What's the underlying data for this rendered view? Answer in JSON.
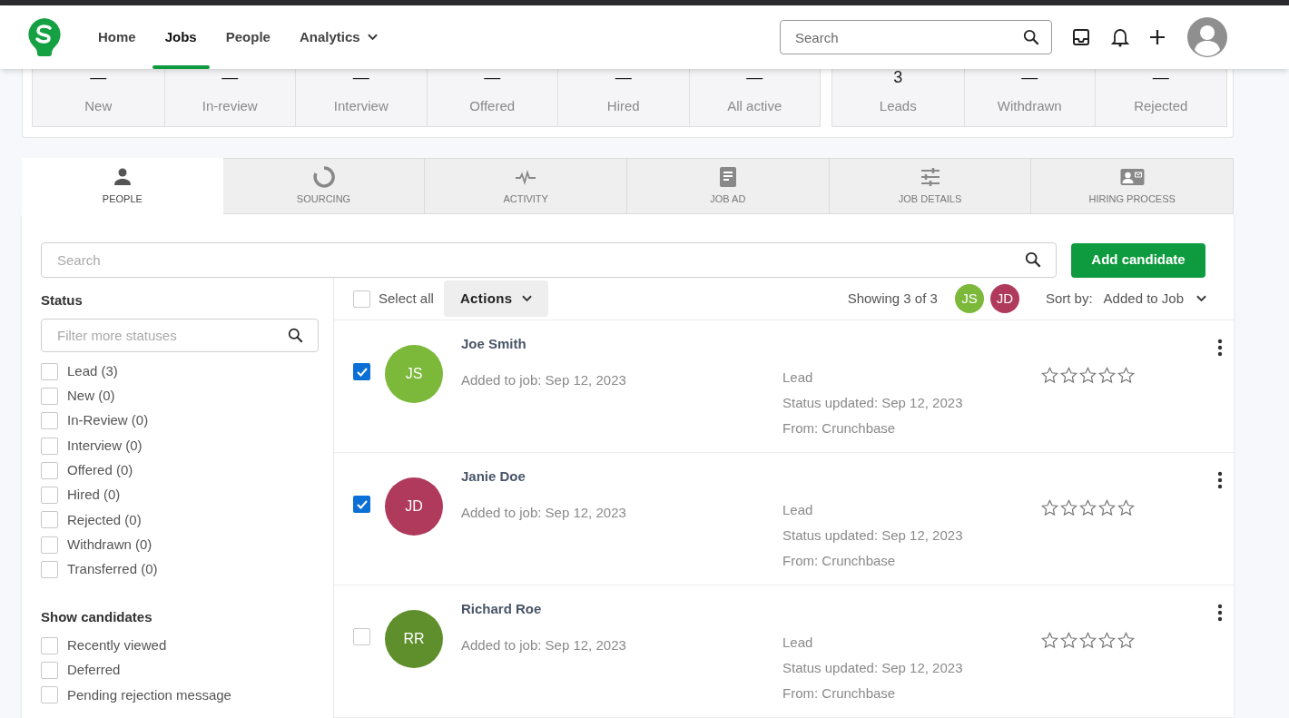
{
  "nav": {
    "items": [
      {
        "label": "Home",
        "selected": false
      },
      {
        "label": "Jobs",
        "selected": true
      },
      {
        "label": "People",
        "selected": false
      },
      {
        "label": "Analytics",
        "selected": false,
        "dropdown": true
      }
    ],
    "search": {
      "placeholder": "Search"
    }
  },
  "pipeline": {
    "groups": [
      [
        {
          "value": "—",
          "label": "New"
        },
        {
          "value": "—",
          "label": "In-review"
        },
        {
          "value": "—",
          "label": "Interview"
        },
        {
          "value": "—",
          "label": "Offered"
        },
        {
          "value": "—",
          "label": "Hired"
        },
        {
          "value": "—",
          "label": "All active"
        }
      ],
      [
        {
          "value": "3",
          "label": "Leads"
        },
        {
          "value": "—",
          "label": "Withdrawn"
        },
        {
          "value": "—",
          "label": "Rejected"
        }
      ]
    ]
  },
  "tabs": [
    {
      "label": "PEOPLE",
      "kind": "person",
      "selected": true
    },
    {
      "label": "SOURCING",
      "kind": "ring",
      "selected": false
    },
    {
      "label": "ACTIVITY",
      "kind": "pulse",
      "selected": false
    },
    {
      "label": "JOB AD",
      "kind": "doc",
      "selected": false
    },
    {
      "label": "JOB DETAILS",
      "kind": "sliders",
      "selected": false
    },
    {
      "label": "HIRING PROCESS",
      "kind": "card",
      "selected": false
    }
  ],
  "search": {
    "placeholder": "Search"
  },
  "add_button": "Add candidate",
  "status_filter": {
    "title": "Status",
    "placeholder": "Filter more statuses",
    "options": [
      {
        "label": "Lead (3)",
        "checked": false
      },
      {
        "label": "New (0)",
        "checked": false
      },
      {
        "label": "In-Review (0)",
        "checked": false
      },
      {
        "label": "Interview (0)",
        "checked": false
      },
      {
        "label": "Offered (0)",
        "checked": false
      },
      {
        "label": "Hired (0)",
        "checked": false
      },
      {
        "label": "Rejected (0)",
        "checked": false
      },
      {
        "label": "Withdrawn (0)",
        "checked": false
      },
      {
        "label": "Transferred (0)",
        "checked": false
      }
    ]
  },
  "show_candidates": {
    "title": "Show candidates",
    "options": [
      {
        "label": "Recently viewed",
        "checked": false
      },
      {
        "label": "Deferred",
        "checked": false
      },
      {
        "label": "Pending rejection message",
        "checked": false
      }
    ]
  },
  "toolbar": {
    "select_all": {
      "label": "Select all",
      "checked": false
    },
    "actions": "Actions",
    "showing": "Showing 3 of 3",
    "selected_avatars": [
      {
        "initials": "JS",
        "color": "#7cb83a"
      },
      {
        "initials": "JD",
        "color": "#b03a5b"
      }
    ],
    "sort_label": "Sort by:",
    "sort_value": "Added to Job"
  },
  "candidates": [
    {
      "name": "Joe Smith",
      "initials": "JS",
      "color": "#7cb83a",
      "checked": true,
      "added": "Added to job: Sep 12, 2023",
      "status": "Lead",
      "status_updated": "Status updated: Sep 12, 2023",
      "source": "From: Crunchbase",
      "stars": 0
    },
    {
      "name": "Janie Doe",
      "initials": "JD",
      "color": "#b03a5b",
      "checked": true,
      "added": "Added to job: Sep 12, 2023",
      "status": "Lead",
      "status_updated": "Status updated: Sep 12, 2023",
      "source": "From: Crunchbase",
      "stars": 0
    },
    {
      "name": "Richard Roe",
      "initials": "RR",
      "color": "#5f8f2c",
      "checked": false,
      "added": "Added to job: Sep 12, 2023",
      "status": "Lead",
      "status_updated": "Status updated: Sep 12, 2023",
      "source": "From: Crunchbase",
      "stars": 0
    }
  ]
}
